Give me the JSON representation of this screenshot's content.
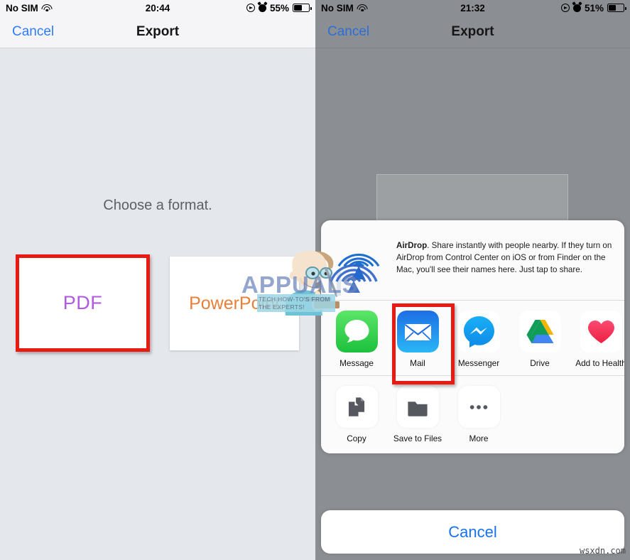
{
  "left_panel": {
    "status_bar": {
      "carrier": "No SIM",
      "wifi_icon": "wifi-icon",
      "time": "20:44",
      "location_icon": "location-arrow-icon",
      "alarm_icon": "alarm-clock-icon",
      "battery_percent": "55%",
      "battery_level": 55
    },
    "nav": {
      "cancel_label": "Cancel",
      "title": "Export"
    },
    "prompt": "Choose a format.",
    "formats": [
      {
        "label": "PDF",
        "selected": true,
        "color": "#b15ae0"
      },
      {
        "label": "PowerPoint",
        "selected": false,
        "color": "#e8803a"
      }
    ]
  },
  "right_panel": {
    "status_bar": {
      "carrier": "No SIM",
      "wifi_icon": "wifi-icon",
      "time": "21:32",
      "location_icon": "location-arrow-icon",
      "alarm_icon": "alarm-clock-icon",
      "battery_percent": "51%",
      "battery_level": 51
    },
    "nav": {
      "cancel_label": "Cancel",
      "title": "Export"
    },
    "share_sheet": {
      "airdrop": {
        "icon": "airdrop-icon",
        "title": "AirDrop",
        "description": ". Share instantly with people nearby. If they turn on AirDrop from Control Center on iOS or from Finder on the Mac, you'll see their names here. Just tap to share."
      },
      "apps": [
        {
          "label": "Message",
          "icon": "messages-icon",
          "highlighted": false
        },
        {
          "label": "Mail",
          "icon": "mail-icon",
          "highlighted": true
        },
        {
          "label": "Messenger",
          "icon": "messenger-icon",
          "highlighted": false
        },
        {
          "label": "Drive",
          "icon": "google-drive-icon",
          "highlighted": false
        },
        {
          "label": "Add to Health",
          "icon": "health-heart-icon",
          "highlighted": false
        }
      ],
      "actions": [
        {
          "label": "Copy",
          "icon": "copy-icon"
        },
        {
          "label": "Save to Files",
          "icon": "folder-icon"
        },
        {
          "label": "More",
          "icon": "ellipsis-icon"
        }
      ],
      "cancel_label": "Cancel"
    }
  },
  "watermarks": {
    "brand": "APPUALS",
    "tagline": "TECH HOW-TO'S FROM THE EXPERTS!",
    "site": "wsxdn.com"
  },
  "colors": {
    "highlight_red": "#e81a11",
    "ios_blue": "#2f7cf6",
    "pdf_purple": "#b15ae0",
    "ppt_orange": "#e8803a"
  }
}
